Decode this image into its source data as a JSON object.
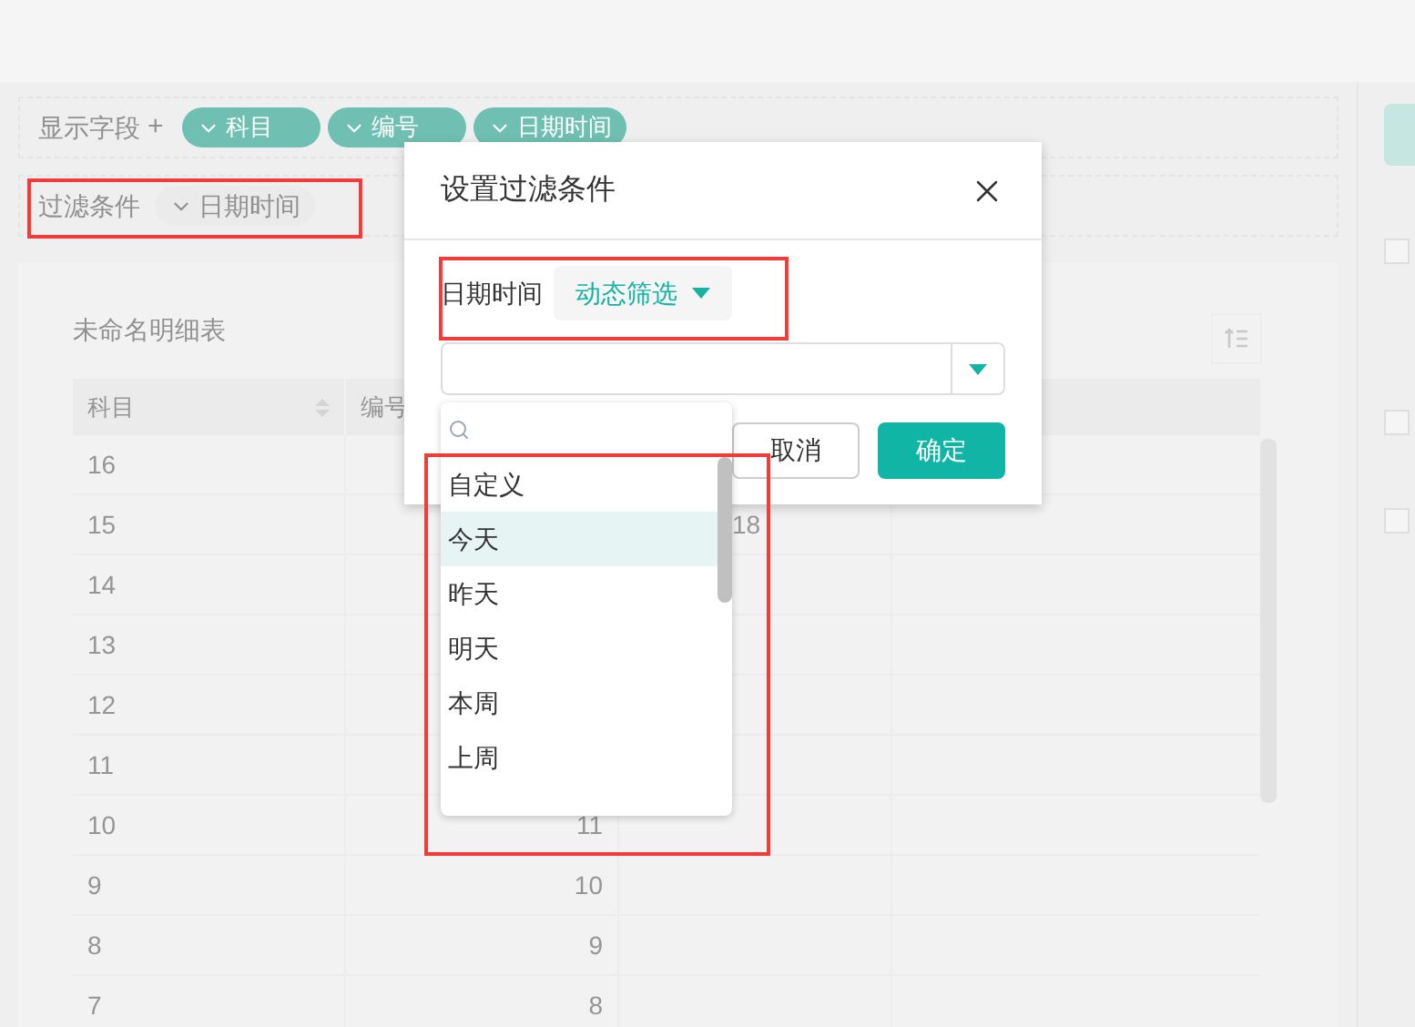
{
  "field_bar": {
    "label": "显示字段",
    "add": "+",
    "fields": [
      "科目",
      "编号",
      "日期时间"
    ]
  },
  "filter_bar": {
    "label": "过滤条件",
    "fields": [
      "日期时间"
    ]
  },
  "report": {
    "title": "未命名明细表",
    "columns": [
      "科目",
      "编号"
    ],
    "rows": [
      {
        "subject": "16"
      },
      {
        "subject": "15",
        "column_3": "18"
      },
      {
        "subject": "14"
      },
      {
        "subject": "13"
      },
      {
        "subject": "12"
      },
      {
        "subject": "11"
      },
      {
        "subject": "10",
        "number": "11"
      },
      {
        "subject": "9",
        "number": "10"
      },
      {
        "subject": "8",
        "number": "9"
      },
      {
        "subject": "7",
        "number": "8"
      }
    ]
  },
  "side_panel": {
    "checkboxes": [
      {
        "checked": false
      },
      {
        "checked": false
      },
      {
        "checked": false
      }
    ]
  },
  "dialog": {
    "title": "设置过滤条件",
    "field_label": "日期时间",
    "mode": "动态筛选",
    "cancel": "取消",
    "confirm": "确定",
    "options": [
      {
        "label": "自定义",
        "selected": false
      },
      {
        "label": "今天",
        "selected": true
      },
      {
        "label": "昨天",
        "selected": false
      },
      {
        "label": "明天",
        "selected": false
      },
      {
        "label": "本周",
        "selected": false
      },
      {
        "label": "上周",
        "selected": false
      }
    ]
  }
}
